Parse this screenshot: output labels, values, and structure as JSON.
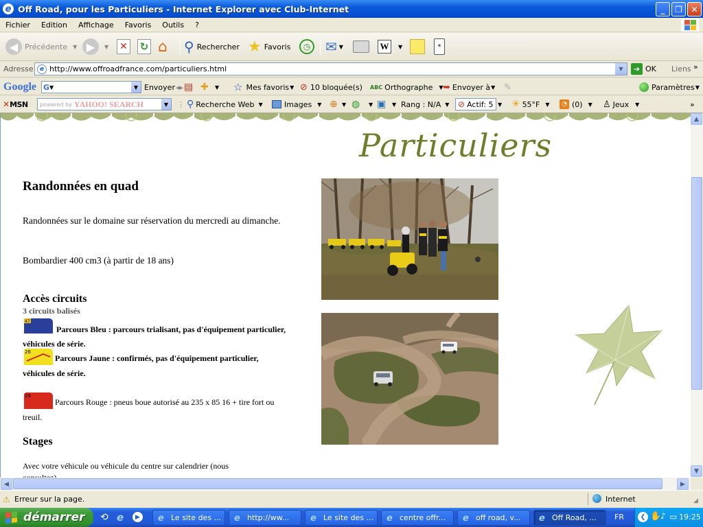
{
  "window": {
    "title": "Off Road, pour les Particuliers - Internet Explorer avec Club-Internet"
  },
  "menu": [
    "Fichier",
    "Edition",
    "Affichage",
    "Favoris",
    "Outils",
    "?"
  ],
  "toolbar": {
    "back": "Précédente",
    "search": "Rechercher",
    "favorites": "Favoris"
  },
  "address": {
    "label": "Adresse",
    "url": "http://www.offroadfrance.com/particuliers.html",
    "go": "OK",
    "links": "Liens"
  },
  "googlebar": {
    "logo": "Google",
    "send": "Envoyer",
    "my_favorites": "Mes favoris",
    "blocked": "10 bloquée(s)",
    "spelling": "Orthographe",
    "send_to": "Envoyer à",
    "settings": "Paramètres"
  },
  "yahoobar": {
    "msn": "MSN",
    "powered": "powered by",
    "yahoo": "YAHOO! SEARCH",
    "web_search": "Recherche Web",
    "images": "Images",
    "rank": "Rang : N/A",
    "active": "Actif: 5",
    "weather": "55°F",
    "rss": "(0)",
    "games": "Jeux"
  },
  "page": {
    "title": "Particuliers",
    "heading": "Randonnées en quad",
    "para1": "Randonnées sur le domaine sur réservation du mercredi au dimanche.",
    "para2": "Bombardier 400 cm3 (à partir de 18 ans)",
    "access_heading": "Accès circuits",
    "circuits_count": "3 circuits balisés",
    "badge_blue": "47",
    "badge_yellow": "26",
    "badge_red": "26",
    "blue": "Parcours Bleu : parcours trialisant, pas d'équipement particulier, véhicules de série.",
    "yellow": "Parcours Jaune : confirmés, pas d'équipement particulier, véhicules de série.",
    "red": "Parcours Rouge : pneus boue autorisé au 235 x 85 16 + tire fort ou treuil.",
    "stages_heading": "Stages",
    "stages_text": "Avec votre véhicule ou véhicule du centre sur calendrier (nous consultez)"
  },
  "status": {
    "error": "Erreur sur la page.",
    "zone": "Internet"
  },
  "taskbar": {
    "start": "démarrer",
    "tasks": [
      "Le site des ...",
      "http://ww...",
      "Le site des ...",
      "centre offr...",
      "off road, v...",
      "Off Road, ..."
    ],
    "lang": "FR",
    "clock": "19:25"
  },
  "colors": {
    "title_green": "#6f7d2a",
    "leaf_green": "#c4cf9a",
    "xp_blue": "#0a5ad8",
    "start_green": "#3c9a36"
  }
}
